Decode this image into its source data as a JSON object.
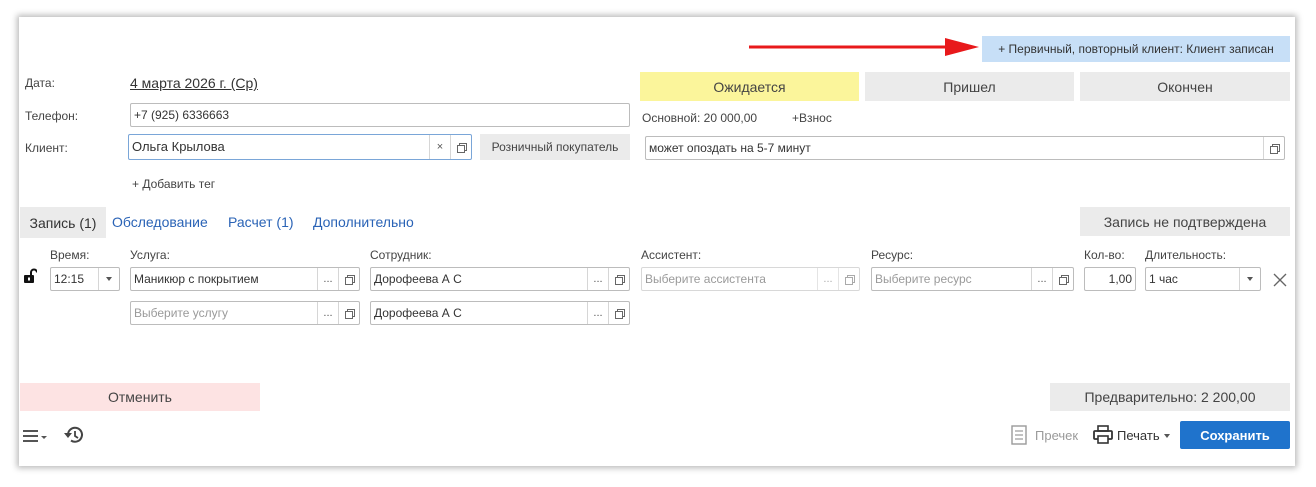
{
  "banner": {
    "text": "+ Первичный, повторный клиент: Клиент записан"
  },
  "form": {
    "date_label": "Дата:",
    "date_value": "4 марта 2026 г. (Ср)",
    "phone_label": "Телефон:",
    "phone_value": "+7 (925) 6336663",
    "client_label": "Клиент:",
    "client_value": "Ольга Крылова",
    "retail_button": "Розничный покупатель",
    "add_tag": "+ Добавить тег"
  },
  "status": {
    "expected": "Ожидается",
    "arrived": "Пришел",
    "finished": "Окончен",
    "expected_color": "#fbf59b"
  },
  "balance": {
    "main": "Основной: 20 000,00",
    "deposit": "+Взнос"
  },
  "comment": {
    "value": "может опоздать на 5-7 минут"
  },
  "tabs": [
    {
      "label": "Запись (1)",
      "active": true
    },
    {
      "label": "Обследование"
    },
    {
      "label": "Расчет (1)"
    },
    {
      "label": "Дополнительно"
    }
  ],
  "not_confirmed_button": "Запись не подтверждена",
  "service_table": {
    "headers": {
      "time": "Время:",
      "service": "Услуга:",
      "employee": "Сотрудник:",
      "assistant": "Ассистент:",
      "resource": "Ресурс:",
      "quantity": "Кол-во:",
      "duration": "Длительность:"
    },
    "row1": {
      "time": "12:15",
      "service": "Маникюр с покрытием",
      "employee": "Дорофеева А С",
      "assistant_placeholder": "Выберите ассистента",
      "resource_placeholder": "Выберите ресурс",
      "quantity": "1,00",
      "duration": "1 час"
    },
    "row2": {
      "service_placeholder": "Выберите услугу",
      "employee": "Дорофеева А С"
    },
    "ellipsis": "..."
  },
  "footer": {
    "cancel": "Отменить",
    "preliminary": "Предварительно: 2 200,00",
    "precheck": "Пречек",
    "print": "Печать",
    "save": "Сохранить"
  },
  "colors": {
    "accent": "#1f73cc",
    "banner_bg": "#c7dff7",
    "cancel_bg": "#fde3e3",
    "arrow": "#e8191b"
  }
}
